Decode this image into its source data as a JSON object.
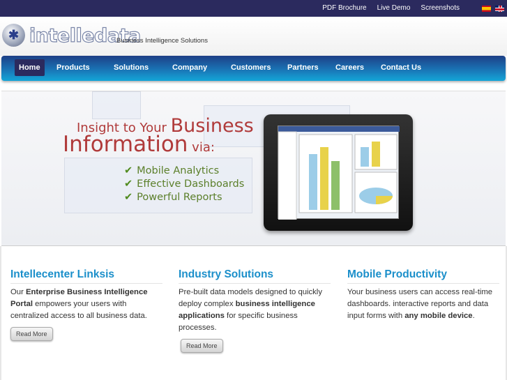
{
  "topbar": {
    "links": [
      "PDF Brochure",
      "Live Demo",
      "Screenshots"
    ],
    "flags": [
      "spanish-flag-icon",
      "english-flag-icon"
    ]
  },
  "header": {
    "logo": "intelledata",
    "tagline": "Business Intelligence Solutions"
  },
  "nav": {
    "items": [
      "Home",
      "Products",
      "Solutions",
      "Company",
      "Customers",
      "Partners",
      "Careers",
      "Contact Us"
    ],
    "active": "Home"
  },
  "hero": {
    "line1_pre": "Insight to Your ",
    "line1_big": "Business",
    "line2_big": "Information",
    "line2_small": " via:",
    "bullets": [
      "Mobile Analytics",
      "Effective Dashboards",
      "Powerful Reports"
    ]
  },
  "columns": [
    {
      "title": "Intellecenter Linksis",
      "pre": "Our ",
      "bold": "Enterprise Business Intelligence Portal",
      "post": " empowers your users with centralized access to all business data.",
      "button": "Read More"
    },
    {
      "title": "Industry Solutions",
      "pre": "Pre-built data models designed to quickly deploy complex ",
      "bold": "business intelligence applications",
      "post": " for specific business processes.",
      "button": "Read More"
    },
    {
      "title": "Mobile Productivity",
      "pre": "Your business users can access real-time dashboards. interactive reports and data input forms with ",
      "bold": "any mobile device",
      "post": "."
    }
  ],
  "colors": {
    "topbar": "#2b2a5e",
    "nav_start": "#1d3f86",
    "nav_end": "#14a6d8",
    "heading": "#1b8fca",
    "hero_text": "#b03a3a",
    "bullet_text": "#5b7f2a"
  }
}
